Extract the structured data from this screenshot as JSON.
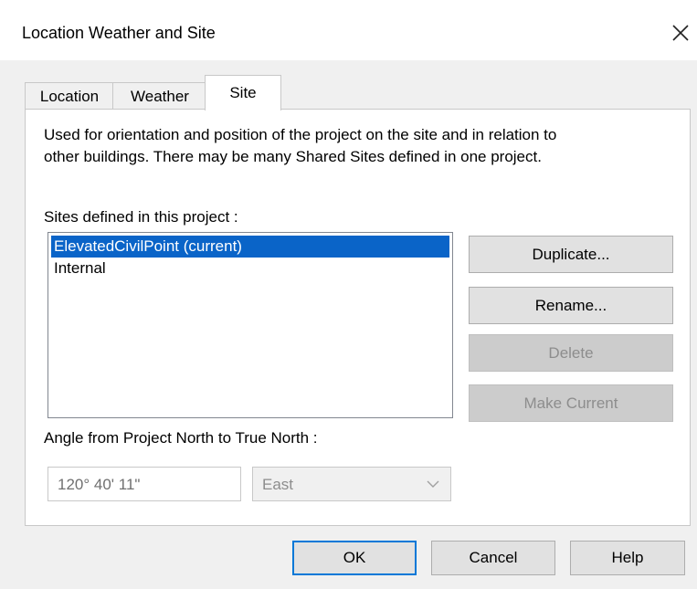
{
  "window": {
    "title": "Location Weather and Site"
  },
  "tabs": [
    {
      "label": "Location"
    },
    {
      "label": "Weather"
    },
    {
      "label": "Site",
      "active": true
    }
  ],
  "site_panel": {
    "description_line1": "Used for orientation and position of the project on the site and in relation to",
    "description_line2": "other buildings. There may be many Shared Sites defined in one project.",
    "sites_label": "Sites defined in this project :",
    "sites": [
      {
        "label": "ElevatedCivilPoint (current)",
        "selected": true
      },
      {
        "label": "Internal",
        "selected": false
      }
    ],
    "buttons": {
      "duplicate": "Duplicate...",
      "rename": "Rename...",
      "delete": "Delete",
      "make_current": "Make Current"
    },
    "angle_label": "Angle from Project North to True North :",
    "angle_value": "120° 40' 11\"",
    "direction_value": "East"
  },
  "footer": {
    "ok": "OK",
    "cancel": "Cancel",
    "help": "Help"
  },
  "icons": {
    "close": "close-icon",
    "dropdown": "chevron-down-icon"
  },
  "colors": {
    "selection": "#0a64c8",
    "default_button_border": "#0078d7"
  }
}
